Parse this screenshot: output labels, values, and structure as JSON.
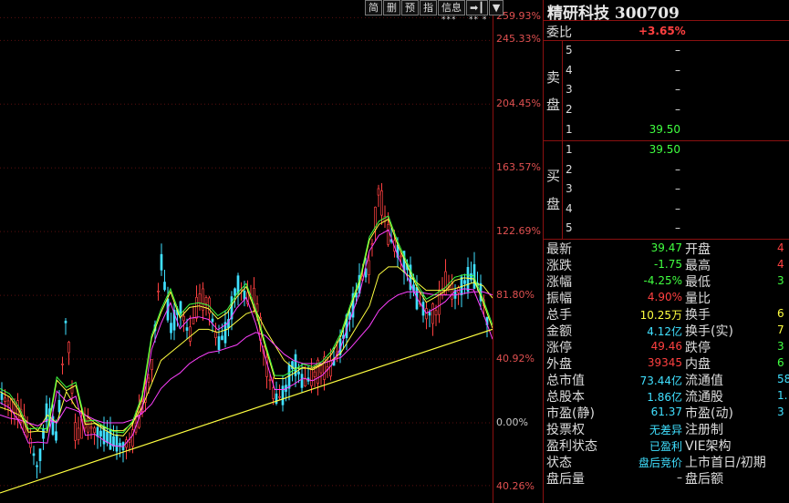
{
  "toolbar": {
    "btn1": "简",
    "btn2": "删",
    "btn3": "预",
    "btn4": "指",
    "btn5": "信息",
    "btn6": "➡┃",
    "btn7": "▼"
  },
  "stars": {
    "a": "***",
    "b": "** *"
  },
  "axis_labels": [
    "259.93%",
    "245.33%",
    "204.45%",
    "163.57%",
    "122.69%",
    "81.80%",
    "40.92%",
    "0.00%",
    "40.26%"
  ],
  "colors": {
    "up": "#ff4040",
    "down": "#40ff40",
    "cyan": "#40e0ff",
    "trend": "#ffff40",
    "grid": "#8a1010"
  },
  "stock": {
    "name": "精研科技",
    "code": "300709",
    "title": "精研科技 300709"
  },
  "weibi": {
    "label": "委比",
    "value": "+3.65%"
  },
  "orderbook": {
    "sell_label": [
      "卖",
      "盘"
    ],
    "buy_label": [
      "买",
      "盘"
    ],
    "sell": [
      {
        "lvl": "5",
        "price": "–"
      },
      {
        "lvl": "4",
        "price": "–"
      },
      {
        "lvl": "3",
        "price": "–"
      },
      {
        "lvl": "2",
        "price": "–"
      },
      {
        "lvl": "1",
        "price": "39.50"
      }
    ],
    "buy": [
      {
        "lvl": "1",
        "price": "39.50"
      },
      {
        "lvl": "2",
        "price": "–"
      },
      {
        "lvl": "3",
        "price": "–"
      },
      {
        "lvl": "4",
        "price": "–"
      },
      {
        "lvl": "5",
        "price": "–"
      }
    ]
  },
  "stats": {
    "zuixin": {
      "label": "最新",
      "value": "39.47"
    },
    "zhangdie": {
      "label": "涨跌",
      "value": "-1.75"
    },
    "zhangfu": {
      "label": "涨幅",
      "value": "-4.25%"
    },
    "zhenfu": {
      "label": "振幅",
      "value": "4.90%"
    },
    "zongshou": {
      "label": "总手",
      "value": "10.25万"
    },
    "jine": {
      "label": "金额",
      "value": "4.12亿"
    },
    "zhangting": {
      "label": "涨停",
      "value": "49.46"
    },
    "waipan": {
      "label": "外盘",
      "value": "39345"
    },
    "zongshizhi": {
      "label": "总市值",
      "value": "73.44亿"
    },
    "zongguben": {
      "label": "总股本",
      "value": "1.86亿"
    },
    "shiyingjing": {
      "label": "市盈(静)",
      "value": "61.37"
    },
    "toupiaoquan": {
      "label": "投票权",
      "value": "无差异"
    },
    "yingli": {
      "label": "盈利状态",
      "value": "已盈利"
    },
    "zhuangtai": {
      "label": "状态",
      "value": "盘后竞价"
    },
    "panhouliang": {
      "label": "盘后量",
      "value": "–"
    },
    "kaipan": {
      "label": "开盘",
      "value": "4"
    },
    "zuigao": {
      "label": "最高",
      "value": "4"
    },
    "zuidi": {
      "label": "最低",
      "value": "3"
    },
    "liangbi": {
      "label": "量比",
      "value": ""
    },
    "huanshou": {
      "label": "换手",
      "value": "6"
    },
    "huanshoushi": {
      "label": "换手(实)",
      "value": "7"
    },
    "dieting": {
      "label": "跌停",
      "value": "3"
    },
    "neipan": {
      "label": "内盘",
      "value": "6"
    },
    "liutongzhi": {
      "label": "流通值",
      "value": "58."
    },
    "liutonggu": {
      "label": "流通股",
      "value": "1."
    },
    "shiyingdong": {
      "label": "市盈(动)",
      "value": "3"
    },
    "zhucezhi": {
      "label": "注册制",
      "value": ""
    },
    "vie": {
      "label": "VIE架构",
      "value": ""
    },
    "shangshi": {
      "label": "上市首日/初期",
      "value": ""
    },
    "panhoue": {
      "label": "盘后额",
      "value": ""
    }
  },
  "chart_data": {
    "type": "line",
    "y_axis_percent_ticks": [
      259.93,
      245.33,
      204.45,
      163.57,
      122.69,
      81.8,
      40.92,
      0.0,
      -40.26
    ],
    "series": [
      {
        "values": [
          18,
          12,
          8,
          -8,
          -30,
          10,
          -10,
          70,
          -10,
          0,
          -5,
          -8,
          -12,
          -15,
          -10,
          10,
          35,
          105,
          60,
          75,
          55,
          80,
          78,
          50,
          60,
          90,
          80,
          80,
          40,
          15,
          18,
          40,
          25,
          30,
          35,
          35,
          50,
          70,
          90,
          100,
          150,
          120,
          110,
          100,
          80,
          70,
          70,
          90,
          82,
          90,
          95,
          80,
          45
        ]
      },
      {
        "values": [
          10,
          8,
          5,
          0,
          -5,
          5,
          0,
          20,
          10,
          5,
          0,
          -3,
          -5,
          -5,
          0,
          10,
          25,
          40,
          45,
          50,
          55,
          60,
          60,
          58,
          60,
          65,
          70,
          72,
          60,
          50,
          40,
          35,
          35,
          35,
          38,
          40,
          45,
          55,
          65,
          75,
          95,
          100,
          100,
          95,
          90,
          85,
          85,
          85,
          86,
          88,
          90,
          88,
          80
        ]
      },
      {
        "values": [
          5,
          3,
          2,
          0,
          -2,
          2,
          0,
          10,
          8,
          5,
          2,
          0,
          0,
          0,
          2,
          6,
          12,
          22,
          28,
          32,
          38,
          42,
          45,
          46,
          48,
          50,
          55,
          58,
          56,
          50,
          44,
          40,
          38,
          38,
          38,
          40,
          42,
          48,
          55,
          62,
          72,
          78,
          82,
          84,
          84,
          83,
          82,
          82,
          82,
          83,
          84,
          84,
          82
        ]
      }
    ],
    "trendline": {
      "from": -45,
      "to": 60
    }
  }
}
